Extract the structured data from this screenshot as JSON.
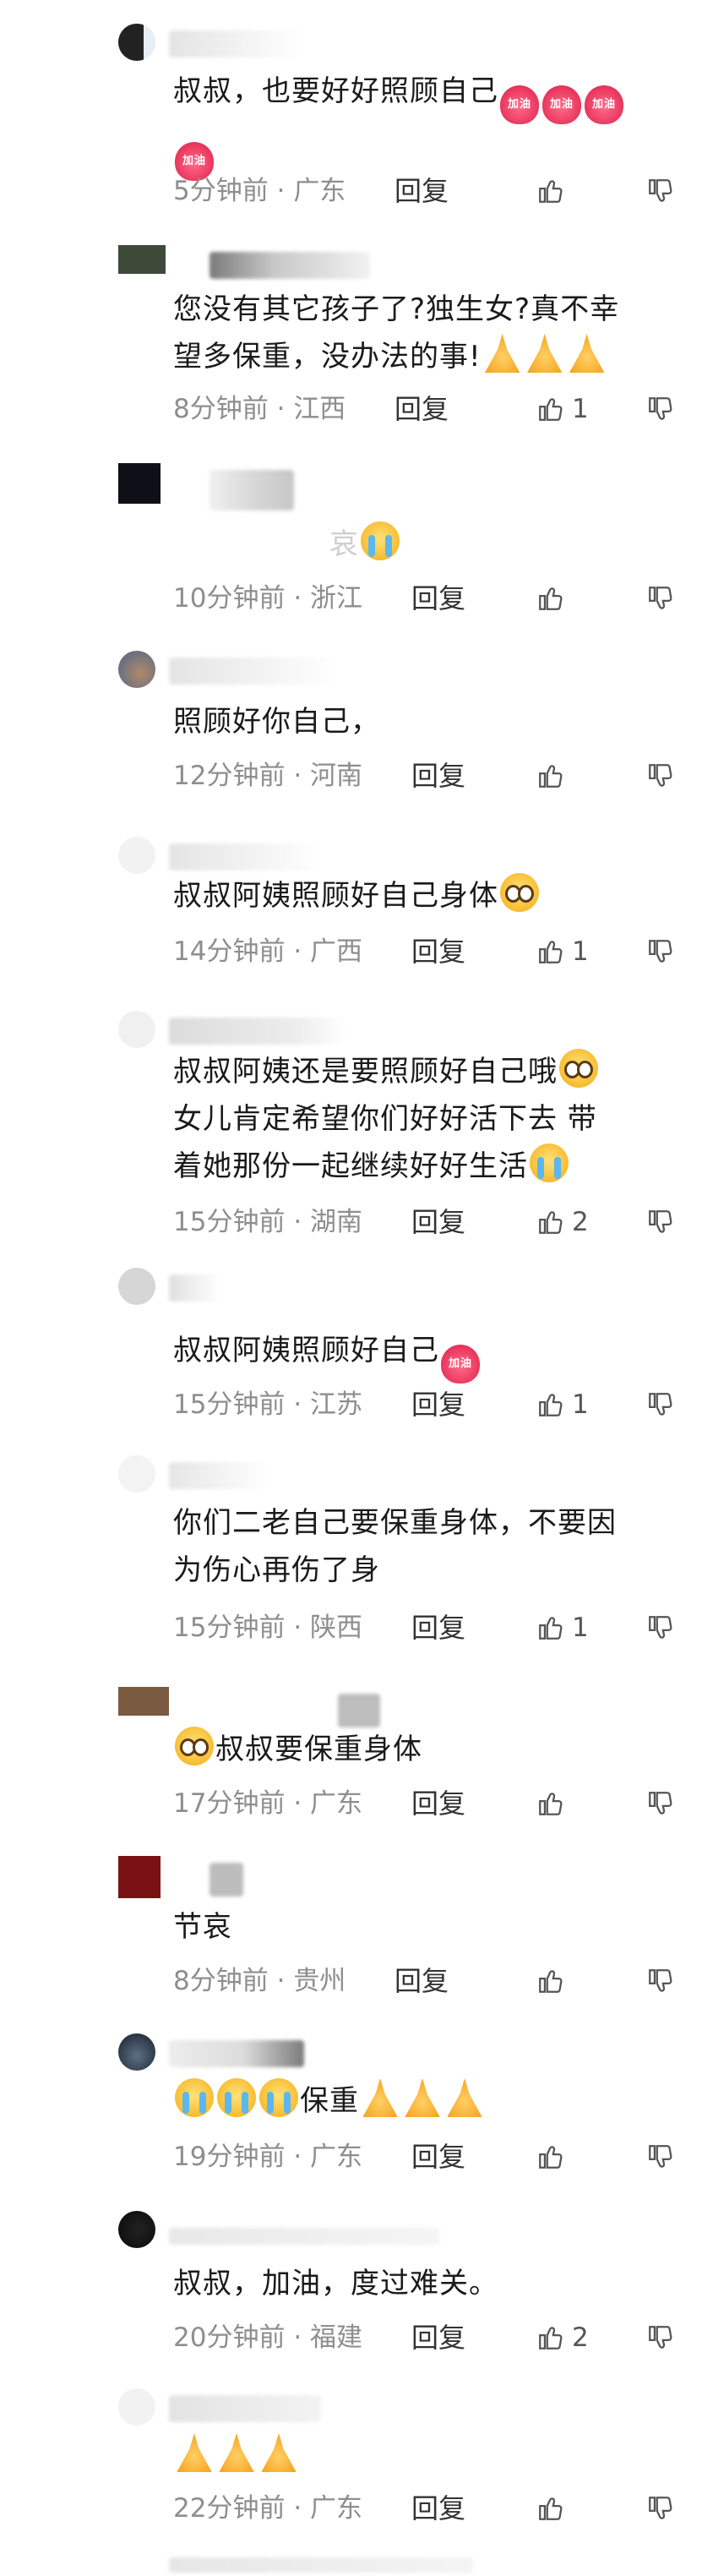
{
  "comments": [
    {
      "text_lines": [
        "叔叔，也要好好照顾自己"
      ],
      "time": "5分钟前",
      "region": "广东",
      "reply": "回复",
      "likes": ""
    },
    {
      "text_lines": [
        "您没有其它孩子了?独生女?真不幸",
        "望多保重，没办法的事!"
      ],
      "time": "8分钟前",
      "region": "江西",
      "reply": "回复",
      "likes": "1"
    },
    {
      "text_lines": [
        "哀"
      ],
      "time": "10分钟前",
      "region": "浙江",
      "reply": "回复",
      "likes": ""
    },
    {
      "text_lines": [
        "照顾好你自己，"
      ],
      "time": "12分钟前",
      "region": "河南",
      "reply": "回复",
      "likes": ""
    },
    {
      "text_lines": [
        "叔叔阿姨照顾好自己身体"
      ],
      "time": "14分钟前",
      "region": "广西",
      "reply": "回复",
      "likes": "1"
    },
    {
      "text_lines": [
        "叔叔阿姨还是要照顾好自己哦",
        "女儿肯定希望你们好好活下去 带",
        "着她那份一起继续好好生活"
      ],
      "time": "15分钟前",
      "region": "湖南",
      "reply": "回复",
      "likes": "2"
    },
    {
      "text_lines": [
        "叔叔阿姨照顾好自己"
      ],
      "time": "15分钟前",
      "region": "江苏",
      "reply": "回复",
      "likes": "1"
    },
    {
      "text_lines": [
        "你们二老自己要保重身体，不要因",
        "为伤心再伤了身"
      ],
      "time": "15分钟前",
      "region": "陕西",
      "reply": "回复",
      "likes": "1"
    },
    {
      "text_lines": [
        "叔叔要保重身体"
      ],
      "time": "17分钟前",
      "region": "广东",
      "reply": "回复",
      "likes": ""
    },
    {
      "text_lines": [
        "节哀"
      ],
      "time": "8分钟前",
      "region": "贵州",
      "reply": "回复",
      "likes": ""
    },
    {
      "text_lines": [
        "保重"
      ],
      "time": "19分钟前",
      "region": "广东",
      "reply": "回复",
      "likes": ""
    },
    {
      "text_lines": [
        "叔叔，加油，度过难关。"
      ],
      "time": "20分钟前",
      "region": "福建",
      "reply": "回复",
      "likes": "2"
    },
    {
      "text_lines": [
        ""
      ],
      "time": "22分钟前",
      "region": "广东",
      "reply": "回复",
      "likes": ""
    }
  ],
  "emoji_labels": {
    "jiayou": "加油"
  },
  "separator": "·",
  "icons": {
    "like": "thumb-up-icon",
    "dislike": "thumb-down-icon"
  },
  "colors": {
    "meta": "#8e8e8e",
    "text": "#1a1a1a",
    "reply": "#333333"
  }
}
